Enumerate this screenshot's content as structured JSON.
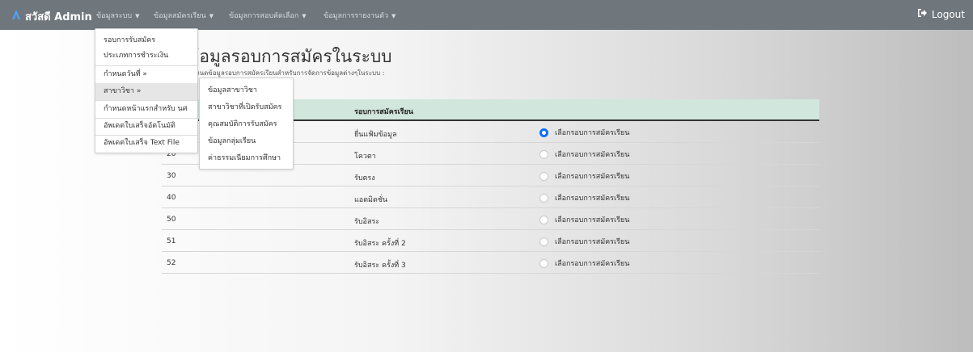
{
  "navbar": {
    "brand": "สวัสดี Admin",
    "items": [
      {
        "label": "ข้อมูลระบบ"
      },
      {
        "label": "ข้อมูลสมัครเรียน"
      },
      {
        "label": "ข้อมูลการสอบคัดเลือก"
      },
      {
        "label": "ข้อมูลการรายงานตัว"
      }
    ],
    "logout_label": "Logout"
  },
  "page": {
    "title": "ข้อมูลรอบการสมัครในระบบ",
    "description": "กำหนดข้อมูลรอบการสมัครเรียนสำหรับการจัดการข้อมูลต่างๆในระบบ :"
  },
  "table": {
    "header": {
      "col2": "รอบการสมัครเรียน"
    },
    "rows": [
      {
        "code": "",
        "name": "ยื่นแฟ้มข้อมูล",
        "action": "เลือกรอบการสมัครเรียน",
        "checked": true
      },
      {
        "code": "20",
        "name": "โควตา",
        "action": "เลือกรอบการสมัครเรียน",
        "checked": false
      },
      {
        "code": "30",
        "name": "รับตรง",
        "action": "เลือกรอบการสมัครเรียน",
        "checked": false
      },
      {
        "code": "40",
        "name": "แอดมิดชั่น",
        "action": "เลือกรอบการสมัครเรียน",
        "checked": false
      },
      {
        "code": "50",
        "name": "รับอิสระ",
        "action": "เลือกรอบการสมัครเรียน",
        "checked": false
      },
      {
        "code": "51",
        "name": "รับอิสระ ครั้งที่ 2",
        "action": "เลือกรอบการสมัครเรียน",
        "checked": false
      },
      {
        "code": "52",
        "name": "รับอิสระ ครั้งที่ 3",
        "action": "เลือกรอบการสมัครเรียน",
        "checked": false
      }
    ]
  },
  "dropdown": {
    "items": [
      {
        "label": "รอบการรับสมัคร"
      },
      {
        "label": "ประเภทการชำระเงิน"
      },
      {
        "label": "กำหนดวันที่ »"
      },
      {
        "label": "สาขาวิชา »"
      },
      {
        "label": "กำหนดหน้าแรกสำหรับ นศ"
      },
      {
        "label": "อัพเดตใบเสร็จอัตโนมัติ"
      },
      {
        "label": "อัพเดตใบเสร็จ Text File"
      }
    ]
  },
  "submenu": {
    "items": [
      {
        "label": "ข้อมูลสาขาวิชา"
      },
      {
        "label": "สาขาวิชาที่เปิดรับสมัคร"
      },
      {
        "label": "คุณสมบัติการรับสมัคร"
      },
      {
        "label": "ข้อมูลกลุ่มเรียน"
      },
      {
        "label": "ค่าธรรมเนียมการศึกษา"
      }
    ]
  },
  "colors": {
    "navbar_bg": "#6f777d",
    "table_header_bg": "#d1e7dd",
    "radio_checked": "#0d6efd"
  },
  "icons": {
    "brand": "brand-logo-icon",
    "logout": "logout-icon",
    "caret": "caret-down-icon"
  }
}
